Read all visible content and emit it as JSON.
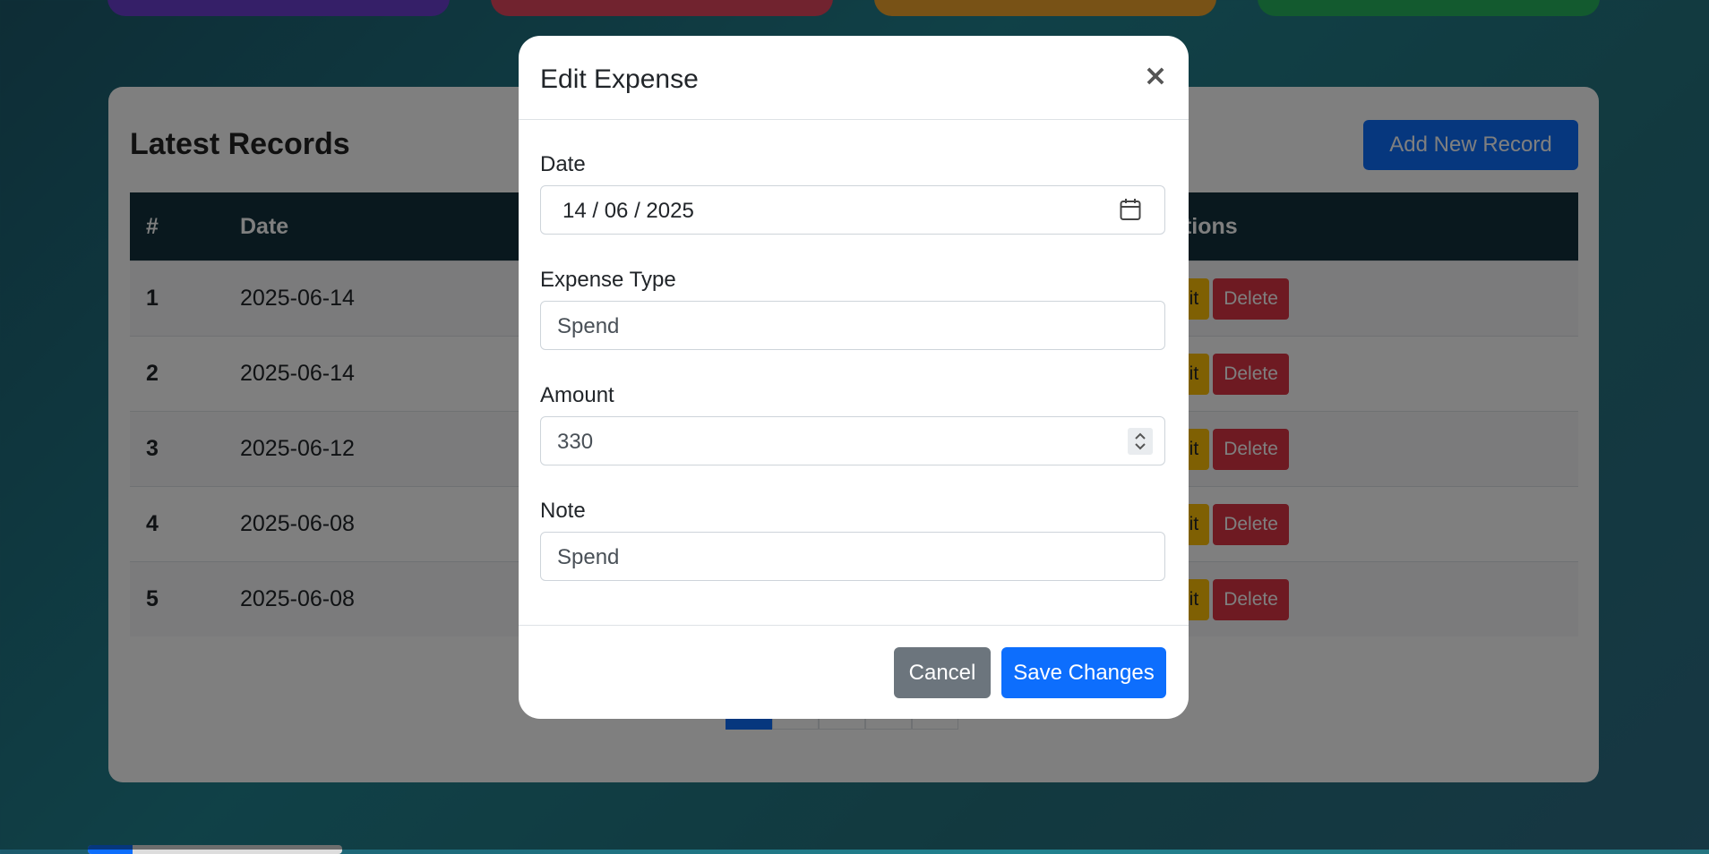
{
  "records": {
    "title": "Latest Records",
    "add_button": "Add New Record",
    "columns": {
      "num": "#",
      "date": "Date",
      "actions": "Actions"
    },
    "rows": [
      {
        "num": "1",
        "date": "2025-06-14"
      },
      {
        "num": "2",
        "date": "2025-06-14"
      },
      {
        "num": "3",
        "date": "2025-06-12"
      },
      {
        "num": "4",
        "date": "2025-06-08"
      },
      {
        "num": "5",
        "date": "2025-06-08"
      }
    ],
    "edit_label": "Edit",
    "delete_label": "Delete"
  },
  "colors": {
    "primary": "#0d6efd",
    "warning": "#ffc107",
    "danger": "#dc3545",
    "secondary": "#6c757d",
    "table_header": "#12313d"
  },
  "modal": {
    "title": "Edit Expense",
    "close_icon": "close-icon",
    "date_label": "Date",
    "date_value": "14 / 06 / 2025",
    "type_label": "Expense Type",
    "type_value": "Spend",
    "amount_label": "Amount",
    "amount_value": "330",
    "note_label": "Note",
    "note_value": "Spend",
    "cancel": "Cancel",
    "save": "Save Changes"
  }
}
